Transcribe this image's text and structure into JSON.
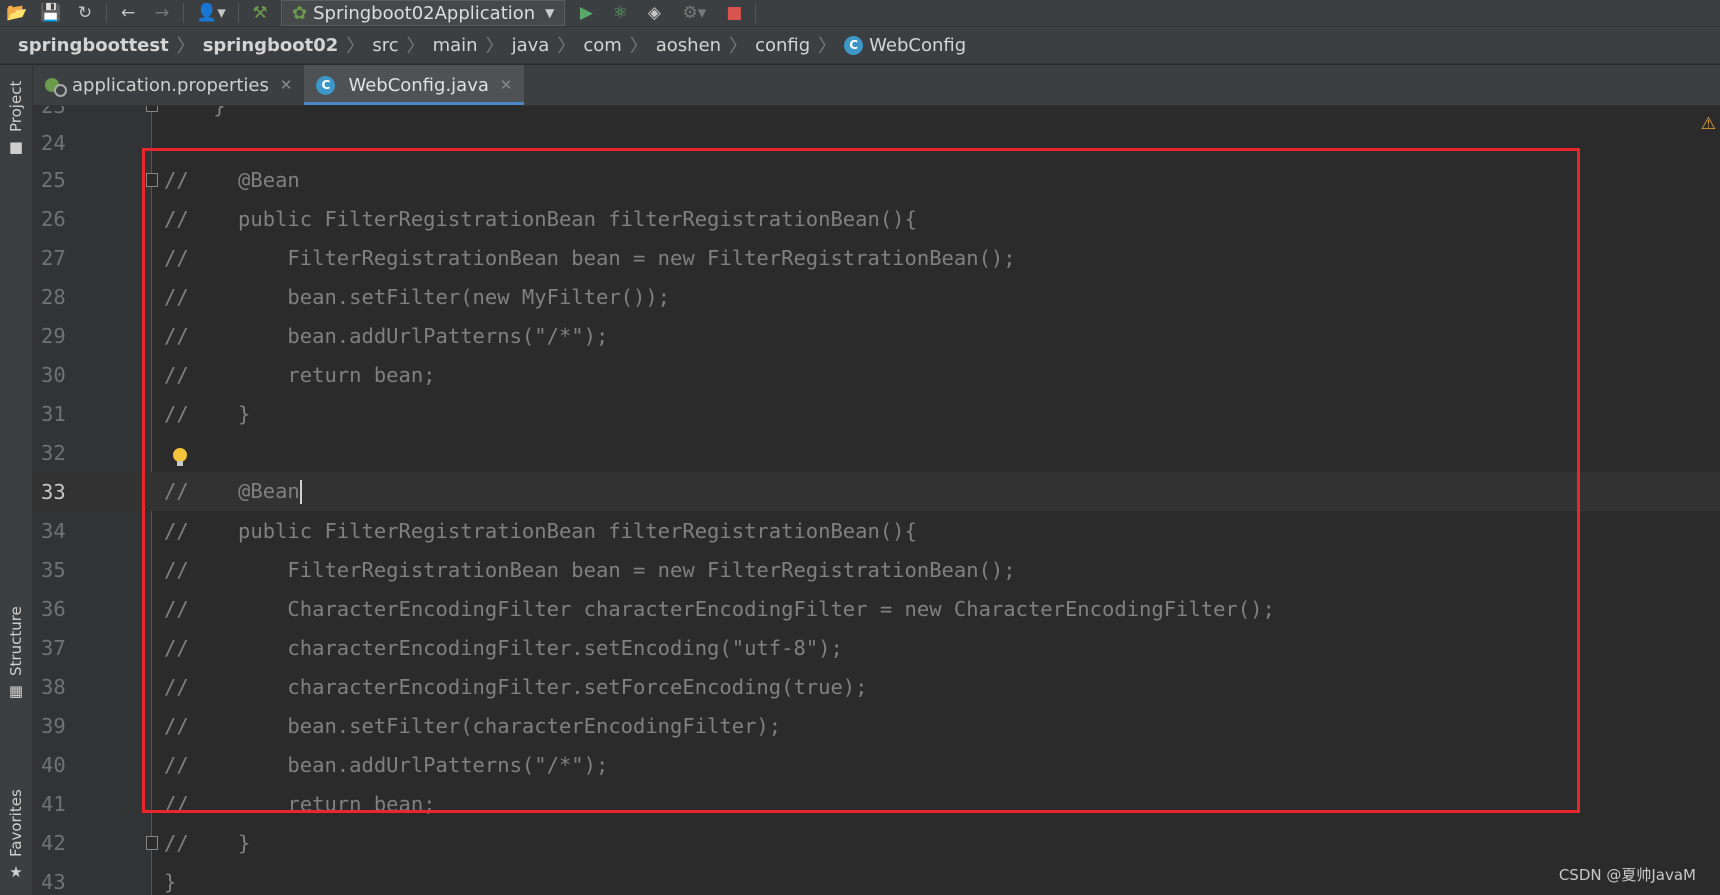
{
  "toolbar": {
    "run_config_label": "Springboot02Application"
  },
  "breadcrumbs": [
    "springboottest",
    "springboot02",
    "src",
    "main",
    "java",
    "com",
    "aoshen",
    "config",
    "WebConfig"
  ],
  "tabs": [
    {
      "label": "application.properties",
      "active": false
    },
    {
      "label": "WebConfig.java",
      "active": true
    }
  ],
  "side_tabs": {
    "project": "Project",
    "structure": "Structure",
    "favorites": "Favorites"
  },
  "editor": {
    "current_line": 33,
    "lines": [
      {
        "n": "23",
        "code": "    }"
      },
      {
        "n": "24",
        "code": ""
      },
      {
        "n": "25",
        "code": "//    @Bean"
      },
      {
        "n": "26",
        "code": "//    public FilterRegistrationBean filterRegistrationBean(){"
      },
      {
        "n": "27",
        "code": "//        FilterRegistrationBean bean = new FilterRegistrationBean();"
      },
      {
        "n": "28",
        "code": "//        bean.setFilter(new MyFilter());"
      },
      {
        "n": "29",
        "code": "//        bean.addUrlPatterns(\"/*\");"
      },
      {
        "n": "30",
        "code": "//        return bean;"
      },
      {
        "n": "31",
        "code": "//    }"
      },
      {
        "n": "32",
        "code": ""
      },
      {
        "n": "33",
        "code": "//    @Bean"
      },
      {
        "n": "34",
        "code": "//    public FilterRegistrationBean filterRegistrationBean(){"
      },
      {
        "n": "35",
        "code": "//        FilterRegistrationBean bean = new FilterRegistrationBean();"
      },
      {
        "n": "36",
        "code": "//        CharacterEncodingFilter characterEncodingFilter = new CharacterEncodingFilter();"
      },
      {
        "n": "37",
        "code": "//        characterEncodingFilter.setEncoding(\"utf-8\");"
      },
      {
        "n": "38",
        "code": "//        characterEncodingFilter.setForceEncoding(true);"
      },
      {
        "n": "39",
        "code": "//        bean.setFilter(characterEncodingFilter);"
      },
      {
        "n": "40",
        "code": "//        bean.addUrlPatterns(\"/*\");"
      },
      {
        "n": "41",
        "code": "//        return bean;"
      },
      {
        "n": "42",
        "code": "//    }"
      },
      {
        "n": "43",
        "code": "}"
      }
    ]
  },
  "warning_icon": "warning-icon",
  "watermark": "CSDN @夏帅JavaM",
  "colors": {
    "highlight_box": "#e8262b",
    "active_tab_underline": "#4a88c7",
    "comment_text": "#808080"
  }
}
